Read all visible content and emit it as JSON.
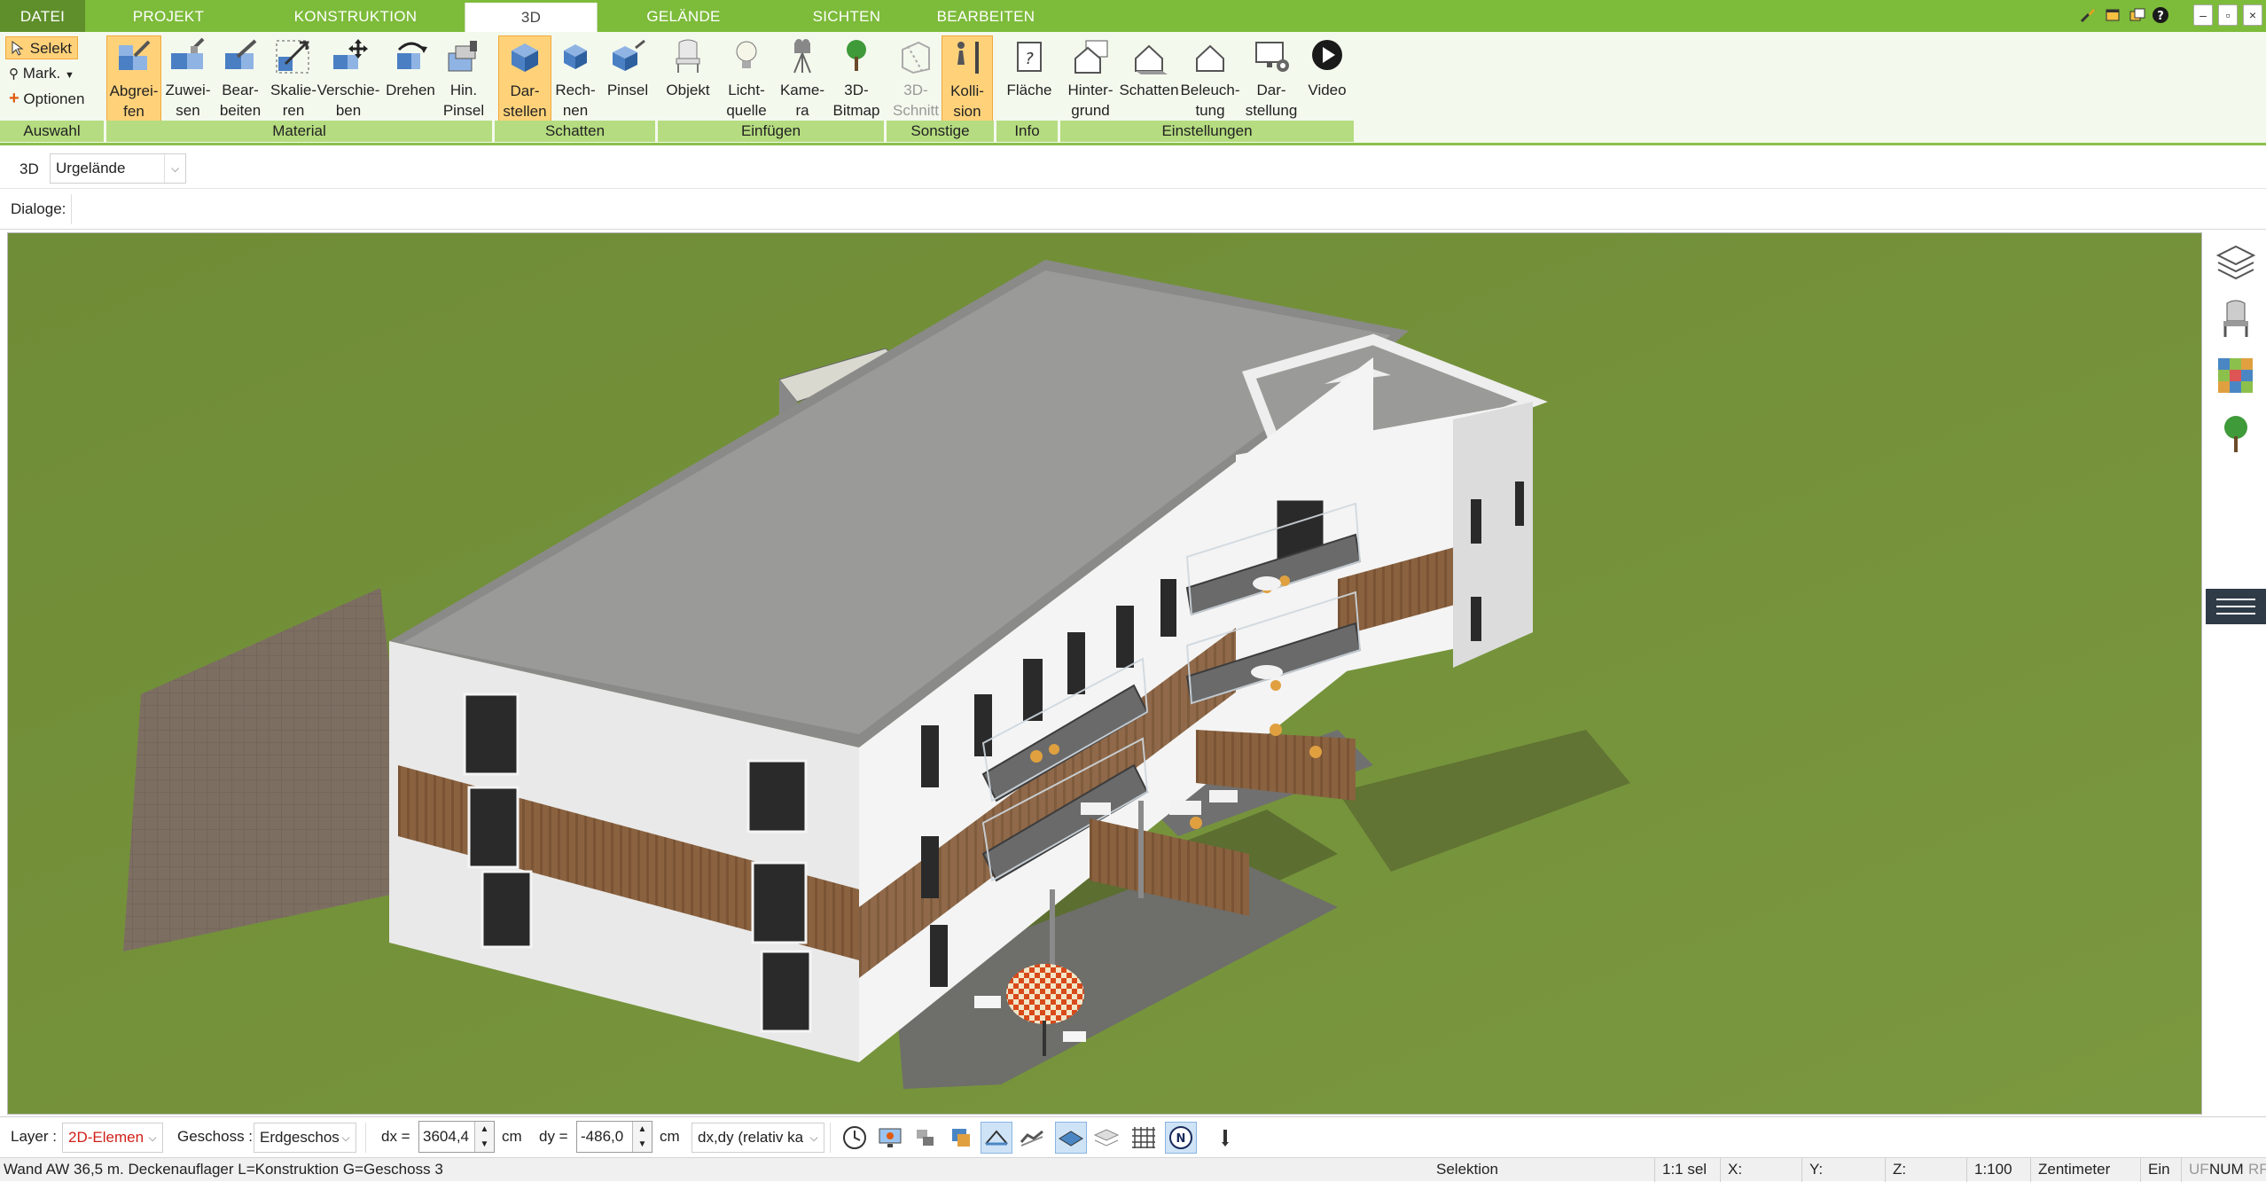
{
  "tabs": [
    {
      "label": "DATEI"
    },
    {
      "label": "PROJEKT"
    },
    {
      "label": "KONSTRUKTION"
    },
    {
      "label": "3D"
    },
    {
      "label": "GELÄNDE"
    },
    {
      "label": "SICHTEN"
    },
    {
      "label": "BEARBEITEN"
    }
  ],
  "selection": {
    "selekt": "Selekt",
    "mark": "Mark.",
    "optionen": "Optionen"
  },
  "ribbon_buttons": {
    "abgreifen": "Abgrei-\nfen",
    "zuweisen": "Zuwei-\nsen",
    "bearbeiten": "Bear-\nbeiten",
    "skalieren": "Skalie-\nren",
    "verschieben": "Verschie-\nben",
    "drehen": "Drehen",
    "hin_pinsel": "Hin.\nPinsel",
    "darstellen": "Dar-\nstellen",
    "rechnen": "Rech-\nnen",
    "pinsel": "Pinsel",
    "objekt": "Objekt",
    "lichtquelle": "Licht-\nquelle",
    "kamera": "Kame-\nra",
    "bitmap": "3D-\nBitmap",
    "schnitt": "3D-\nSchnitt",
    "kollision": "Kolli-\nsion",
    "flaeche": "Fläche",
    "hintergrund": "Hinter-\ngrund",
    "schatten": "Schatten",
    "beleuchtung": "Beleuch-\ntung",
    "darstellung": "Dar-\nstellung",
    "video": "Video"
  },
  "groups": {
    "auswahl": "Auswahl",
    "material": "Material",
    "schatten": "Schatten",
    "einfuegen": "Einfügen",
    "sonstige": "Sonstige",
    "info": "Info",
    "einstellungen": "Einstellungen"
  },
  "view_row": {
    "mode": "3D",
    "layer_select": "Urgelände",
    "dialoge": "Dialoge:"
  },
  "bottom": {
    "layer_label": "Layer :",
    "layer_value": "2D-Elemen",
    "geschoss_label": "Geschoss :",
    "geschoss_value": "Erdgeschos",
    "dx_label": "dx =",
    "dx_value": "3604,4",
    "dx_unit": "cm",
    "dy_label": "dy =",
    "dy_value": "-486,0",
    "dy_unit": "cm",
    "mode_value": "dx,dy (relativ ka"
  },
  "status": {
    "message": "Wand AW 36,5 m. Deckenauflager L=Konstruktion G=Geschoss 3",
    "mode": "Selektion",
    "sel": "1:1 sel",
    "x": "X:",
    "y": "Y:",
    "z": "Z:",
    "scale": "1:100",
    "unit": "Zentimeter",
    "ein": "Ein",
    "uf": "UF",
    "num": "NUM",
    "rf": "RF"
  },
  "colors": {
    "tabbar": "#7dbb3a",
    "ribbon_bg": "#f4f9ee",
    "group_bar": "#b5dc80",
    "active_button": "#ffd27a",
    "grass": "#74913b"
  }
}
